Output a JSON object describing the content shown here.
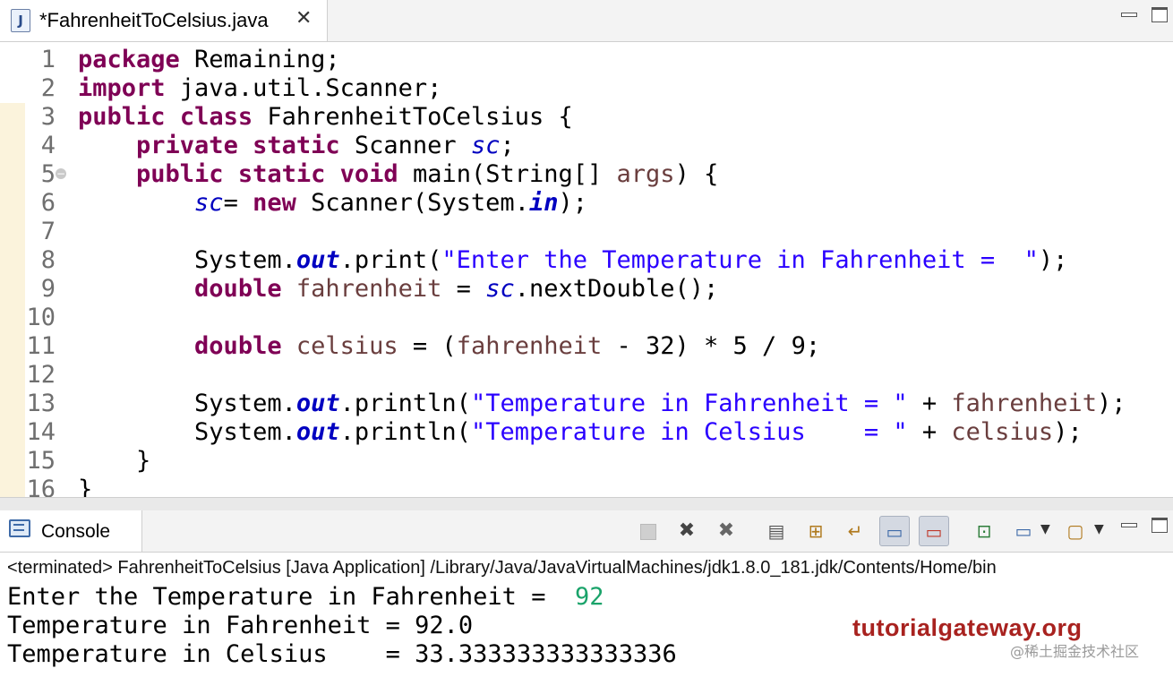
{
  "editor_tab": {
    "title": "*FahrenheitToCelsius.java",
    "icon": "java-file-icon",
    "close_glyph": "✕"
  },
  "code": {
    "lines": [
      {
        "n": "1",
        "tokens": [
          [
            "kw",
            "package"
          ],
          [
            "p",
            " Remaining;"
          ]
        ]
      },
      {
        "n": "2",
        "tokens": [
          [
            "kw",
            "import"
          ],
          [
            "p",
            " java.util.Scanner;"
          ]
        ]
      },
      {
        "n": "3",
        "tokens": [
          [
            "kw",
            "public"
          ],
          [
            "p",
            " "
          ],
          [
            "kw",
            "class"
          ],
          [
            "p",
            " FahrenheitToCelsius {"
          ]
        ]
      },
      {
        "n": "4",
        "tokens": [
          [
            "p",
            "    "
          ],
          [
            "kw",
            "private"
          ],
          [
            "p",
            " "
          ],
          [
            "kw",
            "static"
          ],
          [
            "p",
            " Scanner "
          ],
          [
            "fld",
            "sc"
          ],
          [
            "p",
            ";"
          ]
        ]
      },
      {
        "n": "5",
        "fold": true,
        "tokens": [
          [
            "p",
            "    "
          ],
          [
            "kw",
            "public"
          ],
          [
            "p",
            " "
          ],
          [
            "kw",
            "static"
          ],
          [
            "p",
            " "
          ],
          [
            "kw",
            "void"
          ],
          [
            "p",
            " main(String[] "
          ],
          [
            "var",
            "args"
          ],
          [
            "p",
            ") {"
          ]
        ]
      },
      {
        "n": "6",
        "tokens": [
          [
            "p",
            "        "
          ],
          [
            "fld",
            "sc"
          ],
          [
            "p",
            "= "
          ],
          [
            "kw",
            "new"
          ],
          [
            "p",
            " Scanner(System."
          ],
          [
            "sfld",
            "in"
          ],
          [
            "p",
            ");"
          ]
        ]
      },
      {
        "n": "7",
        "tokens": []
      },
      {
        "n": "8",
        "tokens": [
          [
            "p",
            "        System."
          ],
          [
            "sfld",
            "out"
          ],
          [
            "p",
            ".print("
          ],
          [
            "str",
            "\"Enter the Temperature in Fahrenheit =  \""
          ],
          [
            "p",
            ");"
          ]
        ]
      },
      {
        "n": "9",
        "tokens": [
          [
            "p",
            "        "
          ],
          [
            "kw",
            "double"
          ],
          [
            "p",
            " "
          ],
          [
            "var",
            "fahrenheit"
          ],
          [
            "p",
            " = "
          ],
          [
            "fld",
            "sc"
          ],
          [
            "p",
            ".nextDouble();"
          ]
        ]
      },
      {
        "n": "10",
        "tokens": []
      },
      {
        "n": "11",
        "tokens": [
          [
            "p",
            "        "
          ],
          [
            "kw",
            "double"
          ],
          [
            "p",
            " "
          ],
          [
            "var",
            "celsius"
          ],
          [
            "p",
            " = ("
          ],
          [
            "var",
            "fahrenheit"
          ],
          [
            "p",
            " - 32) * 5 / 9;"
          ]
        ]
      },
      {
        "n": "12",
        "tokens": []
      },
      {
        "n": "13",
        "tokens": [
          [
            "p",
            "        System."
          ],
          [
            "sfld",
            "out"
          ],
          [
            "p",
            ".println("
          ],
          [
            "str",
            "\"Temperature in Fahrenheit = \""
          ],
          [
            "p",
            " + "
          ],
          [
            "var",
            "fahrenheit"
          ],
          [
            "p",
            ");"
          ]
        ]
      },
      {
        "n": "14",
        "tokens": [
          [
            "p",
            "        System."
          ],
          [
            "sfld",
            "out"
          ],
          [
            "p",
            ".println("
          ],
          [
            "str",
            "\"Temperature in Celsius    = \""
          ],
          [
            "p",
            " + "
          ],
          [
            "var",
            "celsius"
          ],
          [
            "p",
            ");"
          ]
        ]
      },
      {
        "n": "15",
        "tokens": [
          [
            "p",
            "    }"
          ]
        ]
      },
      {
        "n": "16",
        "tokens": [
          [
            "p",
            "}"
          ]
        ]
      }
    ]
  },
  "console": {
    "tab_title": "Console",
    "status_path": "<terminated> FahrenheitToCelsius [Java Application] /Library/Java/JavaVirtualMachines/jdk1.8.0_181.jdk/Contents/Home/bin",
    "output": {
      "prompt": "Enter the Temperature in Fahrenheit =  ",
      "user_input": "92",
      "line2": "Temperature in Fahrenheit = 92.0",
      "line3": "Temperature in Celsius    = 33.333333333333336"
    }
  },
  "watermark": {
    "text": "tutorialgateway.org",
    "color": "#a8221f"
  },
  "credit": {
    "text": "@稀土掘金技术社区"
  },
  "colors": {
    "keyword": "#7f0055",
    "field": "#0000c0",
    "string": "#2a00ff",
    "local_var": "#6a3e3e",
    "user_input": "#1aa36a"
  }
}
